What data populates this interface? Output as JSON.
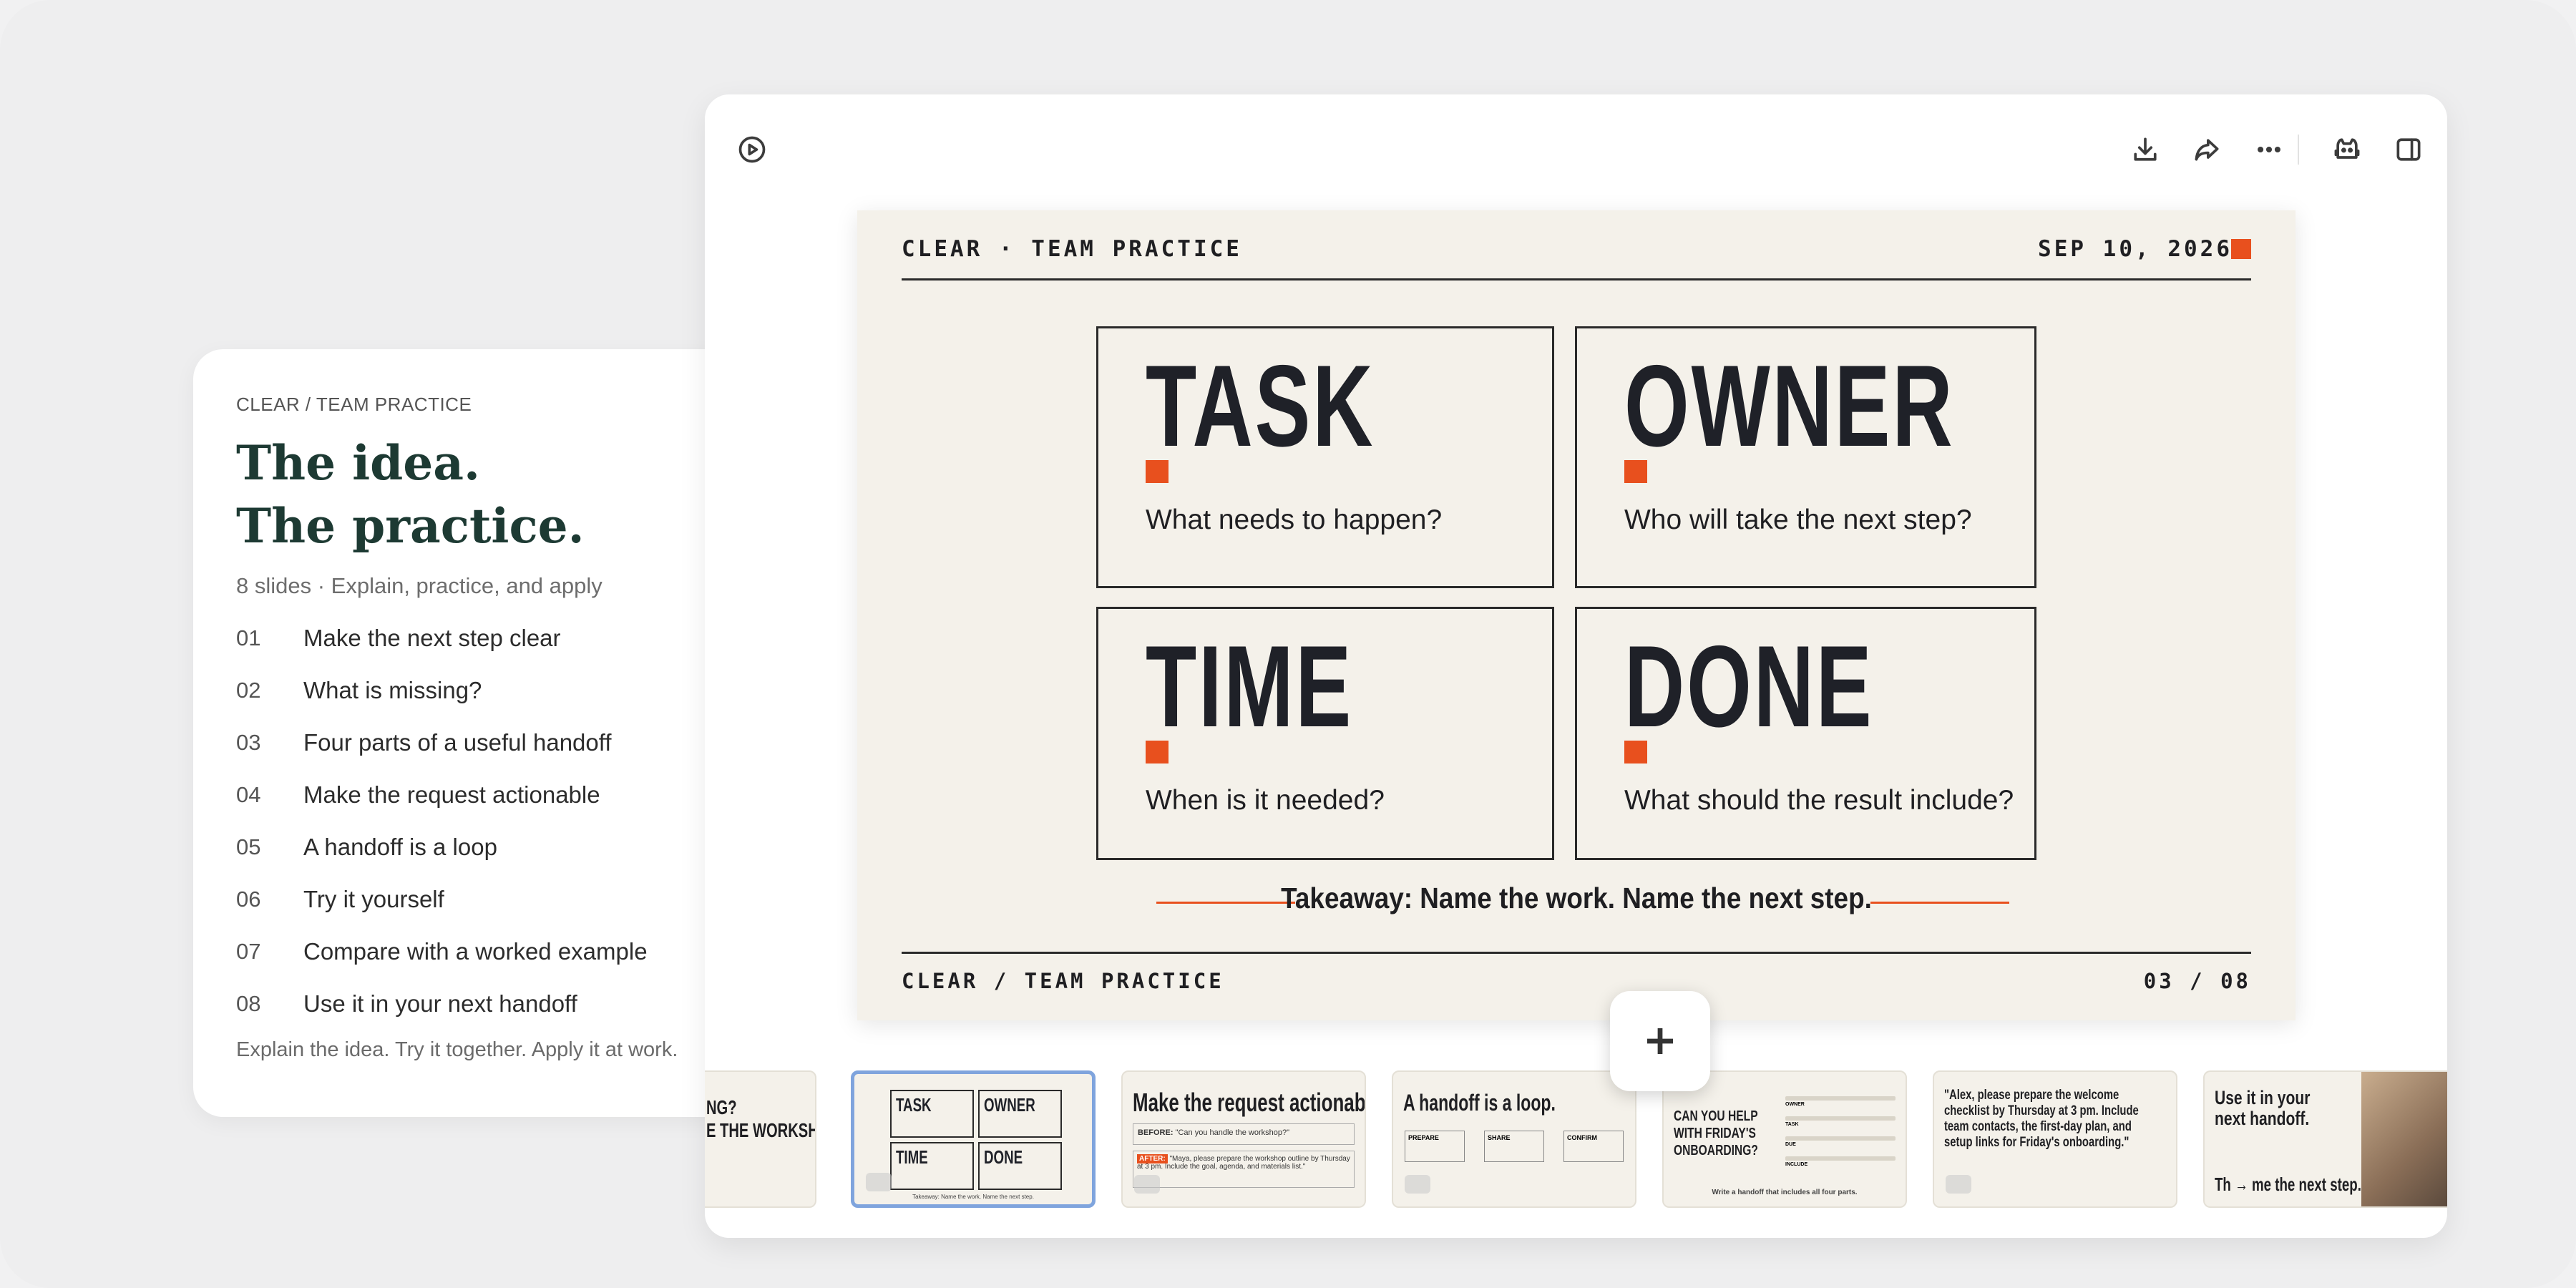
{
  "outline": {
    "kicker": "CLEAR / TEAM PRACTICE",
    "title_line1": "The idea.",
    "title_line2": "The practice.",
    "meta": "8 slides · Explain, practice, and apply",
    "items": [
      {
        "num": "01",
        "label": "Make the next step clear"
      },
      {
        "num": "02",
        "label": "What is missing?"
      },
      {
        "num": "03",
        "label": "Four parts of a useful handoff"
      },
      {
        "num": "04",
        "label": "Make the request actionable"
      },
      {
        "num": "05",
        "label": "A handoff is a loop"
      },
      {
        "num": "06",
        "label": "Try it yourself"
      },
      {
        "num": "07",
        "label": "Compare with a worked example"
      },
      {
        "num": "08",
        "label": "Use it in your next handoff"
      }
    ],
    "footer": "Explain the idea. Try it together. Apply it at work."
  },
  "toolbar": {
    "play_icon": "play-circle-icon",
    "download_icon": "download-icon",
    "share_icon": "share-icon",
    "more_icon": "more-horizontal-icon",
    "assistant_icon": "assistant-icon",
    "sidebar_icon": "sidebar-toggle-icon"
  },
  "slide": {
    "header_left": "CLEAR · TEAM PRACTICE",
    "header_right": "SEP 10, 2026",
    "boxes": [
      {
        "word": "TASK",
        "question": "What needs to happen?"
      },
      {
        "word": "OWNER",
        "question": "Who will take the next step?"
      },
      {
        "word": "TIME",
        "question": "When is it needed?"
      },
      {
        "word": "DONE",
        "question": "What should the result include?"
      }
    ],
    "takeaway": "Takeaway: Name the work. Name the next step.",
    "footer_left": "CLEAR / TEAM PRACTICE",
    "footer_right": "03 / 08",
    "accent_color": "#e8501e"
  },
  "filmstrip": {
    "thumb2_title_a": "NG?",
    "thumb2_title_b": "E THE WORKSHOP?\"",
    "thumb3_cells": [
      "TASK",
      "OWNER",
      "TIME",
      "DONE"
    ],
    "thumb3_caption": "Takeaway: Name the work. Name the next step.",
    "thumb4_title": "Make the request actionable.",
    "thumb4_before_label": "BEFORE:",
    "thumb4_before_text": "\"Can you handle the workshop?\"",
    "thumb4_after_label": "AFTER:",
    "thumb4_after_text": "\"Maya, please prepare the workshop outline by Thursday at 3 pm. Include the goal, agenda, and materials list.\"",
    "thumb5_title": "A handoff is a loop.",
    "thumb5_steps": [
      "PREPARE",
      "SHARE",
      "CONFIRM"
    ],
    "thumb6_question": "CAN YOU HELP WITH FRIDAY'S ONBOARDING?",
    "thumb6_rows": [
      "OWNER",
      "TASK",
      "DUE",
      "INCLUDE"
    ],
    "thumb6_caption": "Write a handoff that includes all four parts.",
    "thumb7_quote": "\"Alex, please prepare the welcome checklist by Thursday at 3 pm. Include team contacts, the first-day plan, and setup links for Friday's onboarding.\"",
    "thumb8_title": "Use it in your next handoff.",
    "thumb8_foot": "Th → me the next step."
  },
  "add_slide_icon": "plus-icon"
}
